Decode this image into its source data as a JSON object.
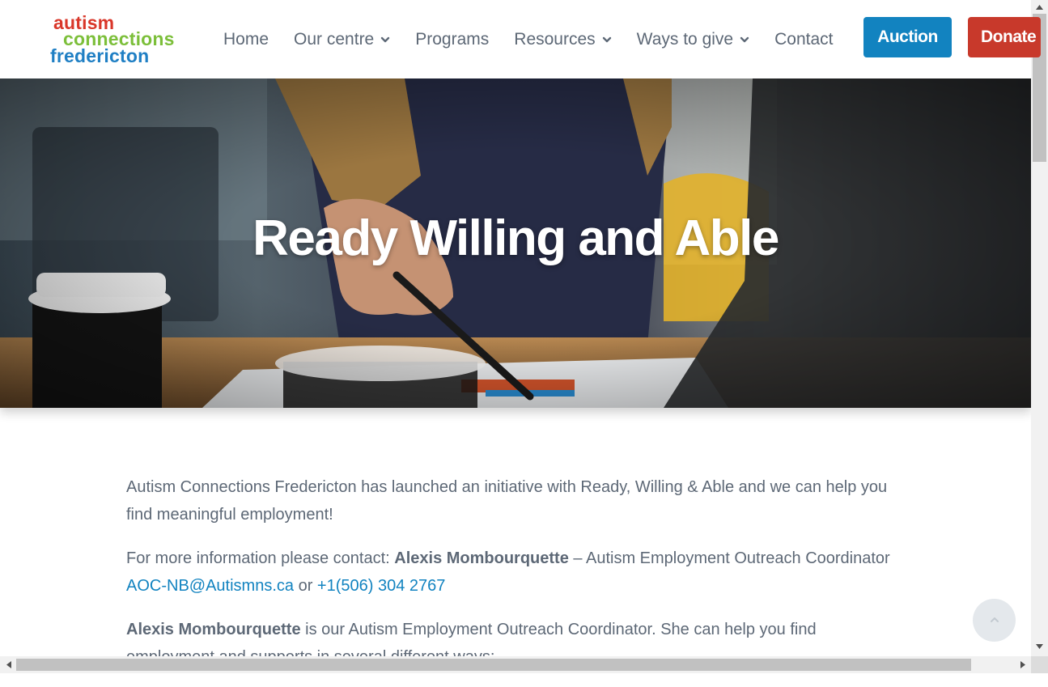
{
  "header": {
    "logo": {
      "line1": "autism",
      "line2": "connections",
      "line3": "fredericton"
    },
    "nav": [
      {
        "label": "Home",
        "dropdown": false
      },
      {
        "label": "Our centre",
        "dropdown": true
      },
      {
        "label": "Programs",
        "dropdown": false
      },
      {
        "label": "Resources",
        "dropdown": true
      },
      {
        "label": "Ways to give",
        "dropdown": true
      },
      {
        "label": "Contact",
        "dropdown": false
      }
    ],
    "buttons": {
      "auction": "Auction",
      "donate": "Donate"
    }
  },
  "hero": {
    "title": "Ready Willing and Able"
  },
  "content": {
    "p1": "Autism Connections Fredericton has launched an initiative with Ready, Willing & Able and we can help you find meaningful employment!",
    "p2": {
      "prefix": "For more information please contact: ",
      "name": "Alexis Mombourquette",
      "middle": " – Autism Employment Outreach Coordinator ",
      "email": "AOC-NB@Autismns.ca",
      "or": " or ",
      "phone": "+1(506) 304 2767"
    },
    "p3": {
      "name": "Alexis Mombourquette",
      "text": " is our Autism Employment Outreach Coordinator. She can help you find employment and supports in several different ways:"
    }
  },
  "colors": {
    "auction": "#1283c0",
    "donate": "#c8392b",
    "link": "#1283c0",
    "text": "#5d6876"
  }
}
